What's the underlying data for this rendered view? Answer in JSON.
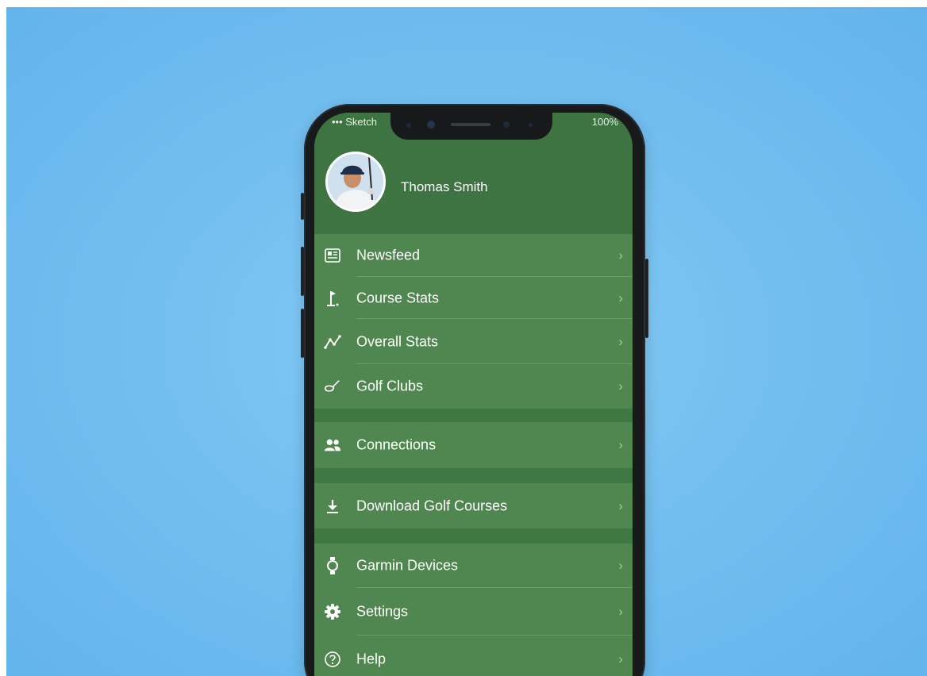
{
  "status_bar": {
    "carrier": "••• Sketch",
    "battery": "100%"
  },
  "profile": {
    "name": "Thomas Smith"
  },
  "menu_groups": [
    [
      {
        "label": "Newsfeed",
        "icon": "newspaper-icon"
      },
      {
        "label": "Course Stats",
        "icon": "golf-flag-icon"
      },
      {
        "label": "Overall Stats",
        "icon": "line-chart-icon"
      },
      {
        "label": "Golf Clubs",
        "icon": "golf-club-icon"
      }
    ],
    [
      {
        "label": "Connections",
        "icon": "people-icon"
      }
    ],
    [
      {
        "label": "Download Golf Courses",
        "icon": "download-icon"
      }
    ],
    [
      {
        "label": "Garmin Devices",
        "icon": "watch-icon"
      },
      {
        "label": "Settings",
        "icon": "gear-icon"
      },
      {
        "label": "Help",
        "icon": "help-icon"
      }
    ]
  ],
  "chevron": "›",
  "colors": {
    "background": "#74bff0",
    "header_green": "#3e7442",
    "row_green": "#50864f",
    "separator_green": "#3f7843"
  }
}
